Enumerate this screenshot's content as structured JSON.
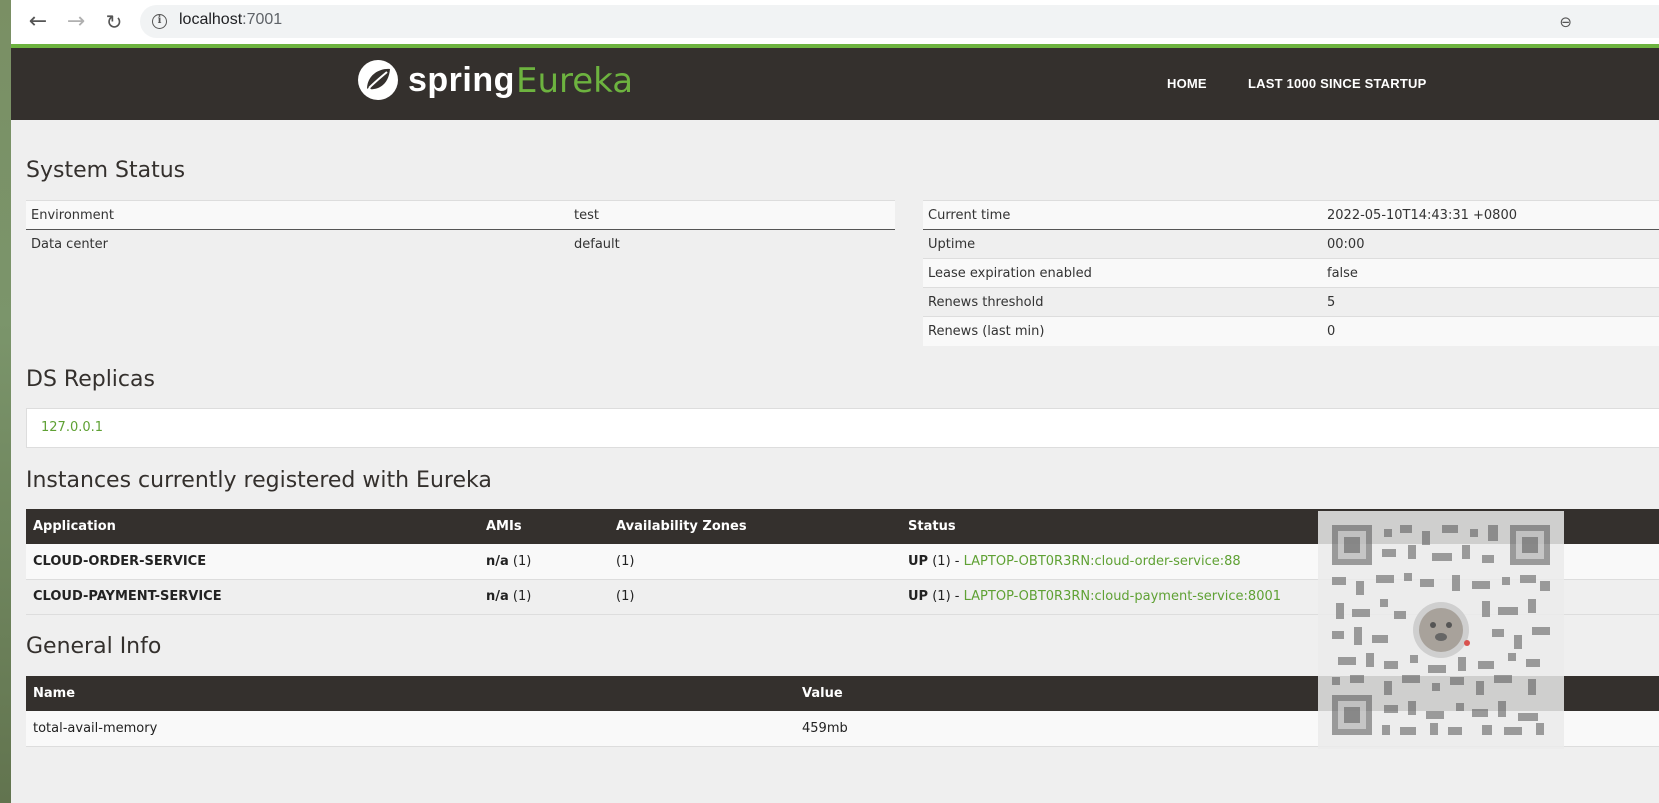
{
  "browser": {
    "url_host": "localhost",
    "url_port": ":7001"
  },
  "header": {
    "logo_word": "spring",
    "logo_product": "Eureka",
    "nav": [
      "HOME",
      "LAST 1000 SINCE STARTUP"
    ]
  },
  "system_status": {
    "title": "System Status",
    "left": [
      {
        "key": "Environment",
        "value": "test"
      },
      {
        "key": "Data center",
        "value": "default"
      }
    ],
    "right": [
      {
        "key": "Current time",
        "value": "2022-05-10T14:43:31 +0800"
      },
      {
        "key": "Uptime",
        "value": "00:00"
      },
      {
        "key": "Lease expiration enabled",
        "value": "false"
      },
      {
        "key": "Renews threshold",
        "value": "5"
      },
      {
        "key": "Renews (last min)",
        "value": "0"
      }
    ]
  },
  "ds_replicas": {
    "title": "DS Replicas",
    "items": [
      "127.0.0.1"
    ]
  },
  "instances": {
    "title": "Instances currently registered with Eureka",
    "headers": [
      "Application",
      "AMIs",
      "Availability Zones",
      "Status"
    ],
    "rows": [
      {
        "application": "CLOUD-ORDER-SERVICE",
        "ami": "n/a",
        "ami_count": "(1)",
        "zones": "(1)",
        "status": "UP",
        "status_count": "(1) -",
        "instance": "LAPTOP-OBT0R3RN:cloud-order-service:88"
      },
      {
        "application": "CLOUD-PAYMENT-SERVICE",
        "ami": "n/a",
        "ami_count": "(1)",
        "zones": "(1)",
        "status": "UP",
        "status_count": "(1) -",
        "instance": "LAPTOP-OBT0R3RN:cloud-payment-service:8001"
      }
    ]
  },
  "general_info": {
    "title": "General Info",
    "headers": [
      "Name",
      "Value"
    ],
    "rows": [
      {
        "name": "total-avail-memory",
        "value": "459mb"
      }
    ]
  },
  "colors": {
    "header_bg": "#34302d",
    "accent_green": "#6db33f",
    "link_green": "#5fa134"
  }
}
